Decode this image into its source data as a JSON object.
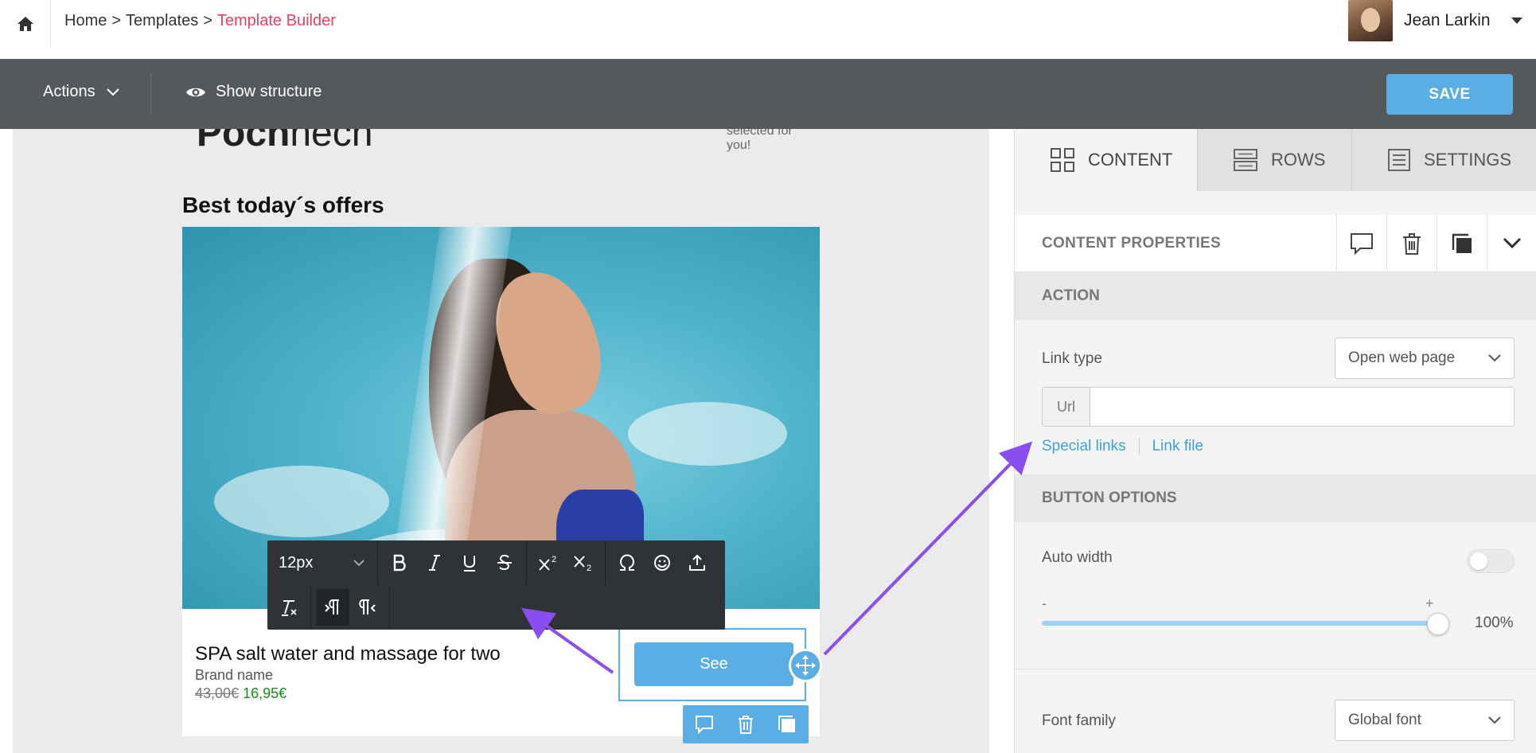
{
  "breadcrumb": {
    "home": "Home",
    "sep": ">",
    "templates": "Templates",
    "current": "Template Builder"
  },
  "user": {
    "name": "Jean Larkin"
  },
  "toolbar": {
    "actions_label": "Actions",
    "structure_label": "Show structure",
    "save_label": "SAVE"
  },
  "email": {
    "logo_bold": "Poch",
    "logo_light": "hech",
    "logo_tagline": "selected for you!",
    "offers_title": "Best today´s offers",
    "product_name": "SPA salt water and massage for two",
    "brand": "Brand name",
    "old_price": "43,00€",
    "new_price": "16,95€",
    "button_label": "See"
  },
  "rte": {
    "font_size": "12px"
  },
  "panel": {
    "tabs": [
      {
        "label": "CONTENT"
      },
      {
        "label": "ROWS"
      },
      {
        "label": "SETTINGS"
      }
    ],
    "content_properties": "CONTENT PROPERTIES",
    "action_section": "ACTION",
    "link_type_label": "Link type",
    "link_type_value": "Open web page",
    "url_addon": "Url",
    "url_value": "",
    "special_links": "Special links",
    "link_file": "Link file",
    "button_options_section": "BUTTON OPTIONS",
    "auto_width_label": "Auto width",
    "slider_minus": "-",
    "slider_plus": "+",
    "width_value": "100%",
    "width_fraction": 1.0,
    "font_family_label": "Font family",
    "font_family_value": "Global font"
  },
  "colors": {
    "accent": "#5aaee3",
    "breadcrumb_current": "#e9415f",
    "toolbar_bg": "#55595c",
    "annotation_arrow": "#8a4df0",
    "new_price": "#1d8a1d"
  }
}
